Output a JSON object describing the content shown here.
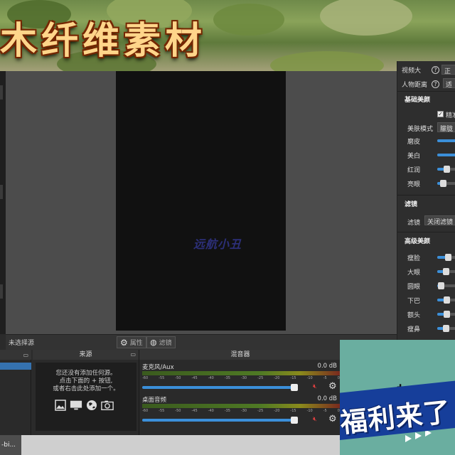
{
  "banner": {
    "text": "木纤维素材"
  },
  "preview": {
    "watermark": "远航小丑"
  },
  "right_panel": {
    "top_label_1": "视频大",
    "top_value_1": "正",
    "distance_label": "人物距离",
    "distance_value": "适",
    "basic_beauty": {
      "header": "基础美颜",
      "checkbox_label": "精准",
      "mode_label": "美肤模式",
      "mode_value": "朦胧",
      "items": [
        {
          "label": "磨皮",
          "value": 0.95
        },
        {
          "label": "美白",
          "value": 0.95
        },
        {
          "label": "红润",
          "value": 0.55
        },
        {
          "label": "亮眼",
          "value": 0.35
        }
      ]
    },
    "filter": {
      "header": "滤镜",
      "label": "滤镜",
      "button": "关闭滤镜"
    },
    "advanced_beauty": {
      "header": "高级美颜",
      "items": [
        {
          "label": "瘦脸",
          "value": 0.6
        },
        {
          "label": "大眼",
          "value": 0.5
        },
        {
          "label": "圆眼",
          "value": 0.25
        },
        {
          "label": "下巴",
          "value": 0.55
        },
        {
          "label": "额头",
          "value": 0.55
        },
        {
          "label": "瘦鼻",
          "value": 0.5
        }
      ]
    }
  },
  "under_bar": {
    "no_source": "未选择源",
    "properties": "属性",
    "filters": "滤镜"
  },
  "sources": {
    "header": "来源",
    "hint_lines": [
      "您还没有添加任何源。",
      "点击下面的 + 按钮,",
      "或者右击此处添加一个。"
    ]
  },
  "mixer": {
    "header": "混音器",
    "channels": [
      {
        "name": "麦克风/Aux",
        "db": "0.0 dB",
        "volume": 0.92
      },
      {
        "name": "桌面音频",
        "db": "0.0 dB",
        "volume": 0.92
      }
    ],
    "ticks": [
      "-60",
      "-55",
      "-50",
      "-45",
      "-40",
      "-35",
      "-30",
      "-25",
      "-20",
      "-15",
      "-10",
      "-5",
      "0"
    ]
  },
  "taskbar": {
    "item": "-bi..."
  },
  "overlay": {
    "text": "福利来了"
  },
  "colors": {
    "accent": "#3b8fd9",
    "preview_bg": "#111111",
    "overlay_band": "#163e9a",
    "overlay_bg": "#6aaea0"
  }
}
